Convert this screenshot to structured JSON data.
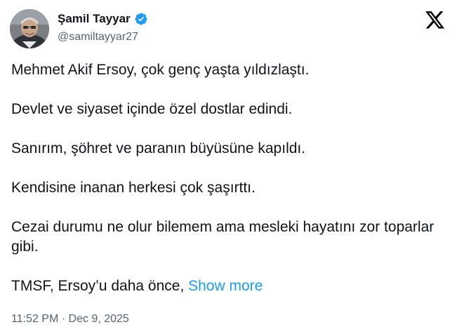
{
  "author": {
    "display_name": "Şamil Tayyar",
    "handle": "@samiltayyar27",
    "verified_icon": "verified-badge-icon"
  },
  "platform": {
    "logo_icon": "x-logo-icon"
  },
  "tweet": {
    "paragraphs": [
      "Mehmet Akif Ersoy, çok genç yaşta yıldızlaştı.",
      "Devlet ve siyaset içinde özel dostlar edindi.",
      "Sanırım, şöhret ve paranın büyüsüne kapıldı.",
      "Kendisine inanan herkesi çok şaşırttı.",
      "Cezai durumu ne olur bilemem ama mesleki hayatını zor toparlar gibi."
    ],
    "truncated_text": "TMSF, Ersoy’u daha önce, ",
    "show_more_label": "Show more"
  },
  "meta": {
    "time": "11:52 PM",
    "separator": " · ",
    "date": "Dec 9, 2025"
  },
  "colors": {
    "link": "#1d9bf0",
    "secondary_text": "#536471",
    "primary_text": "#0f1419",
    "verified": "#1d9bf0"
  }
}
